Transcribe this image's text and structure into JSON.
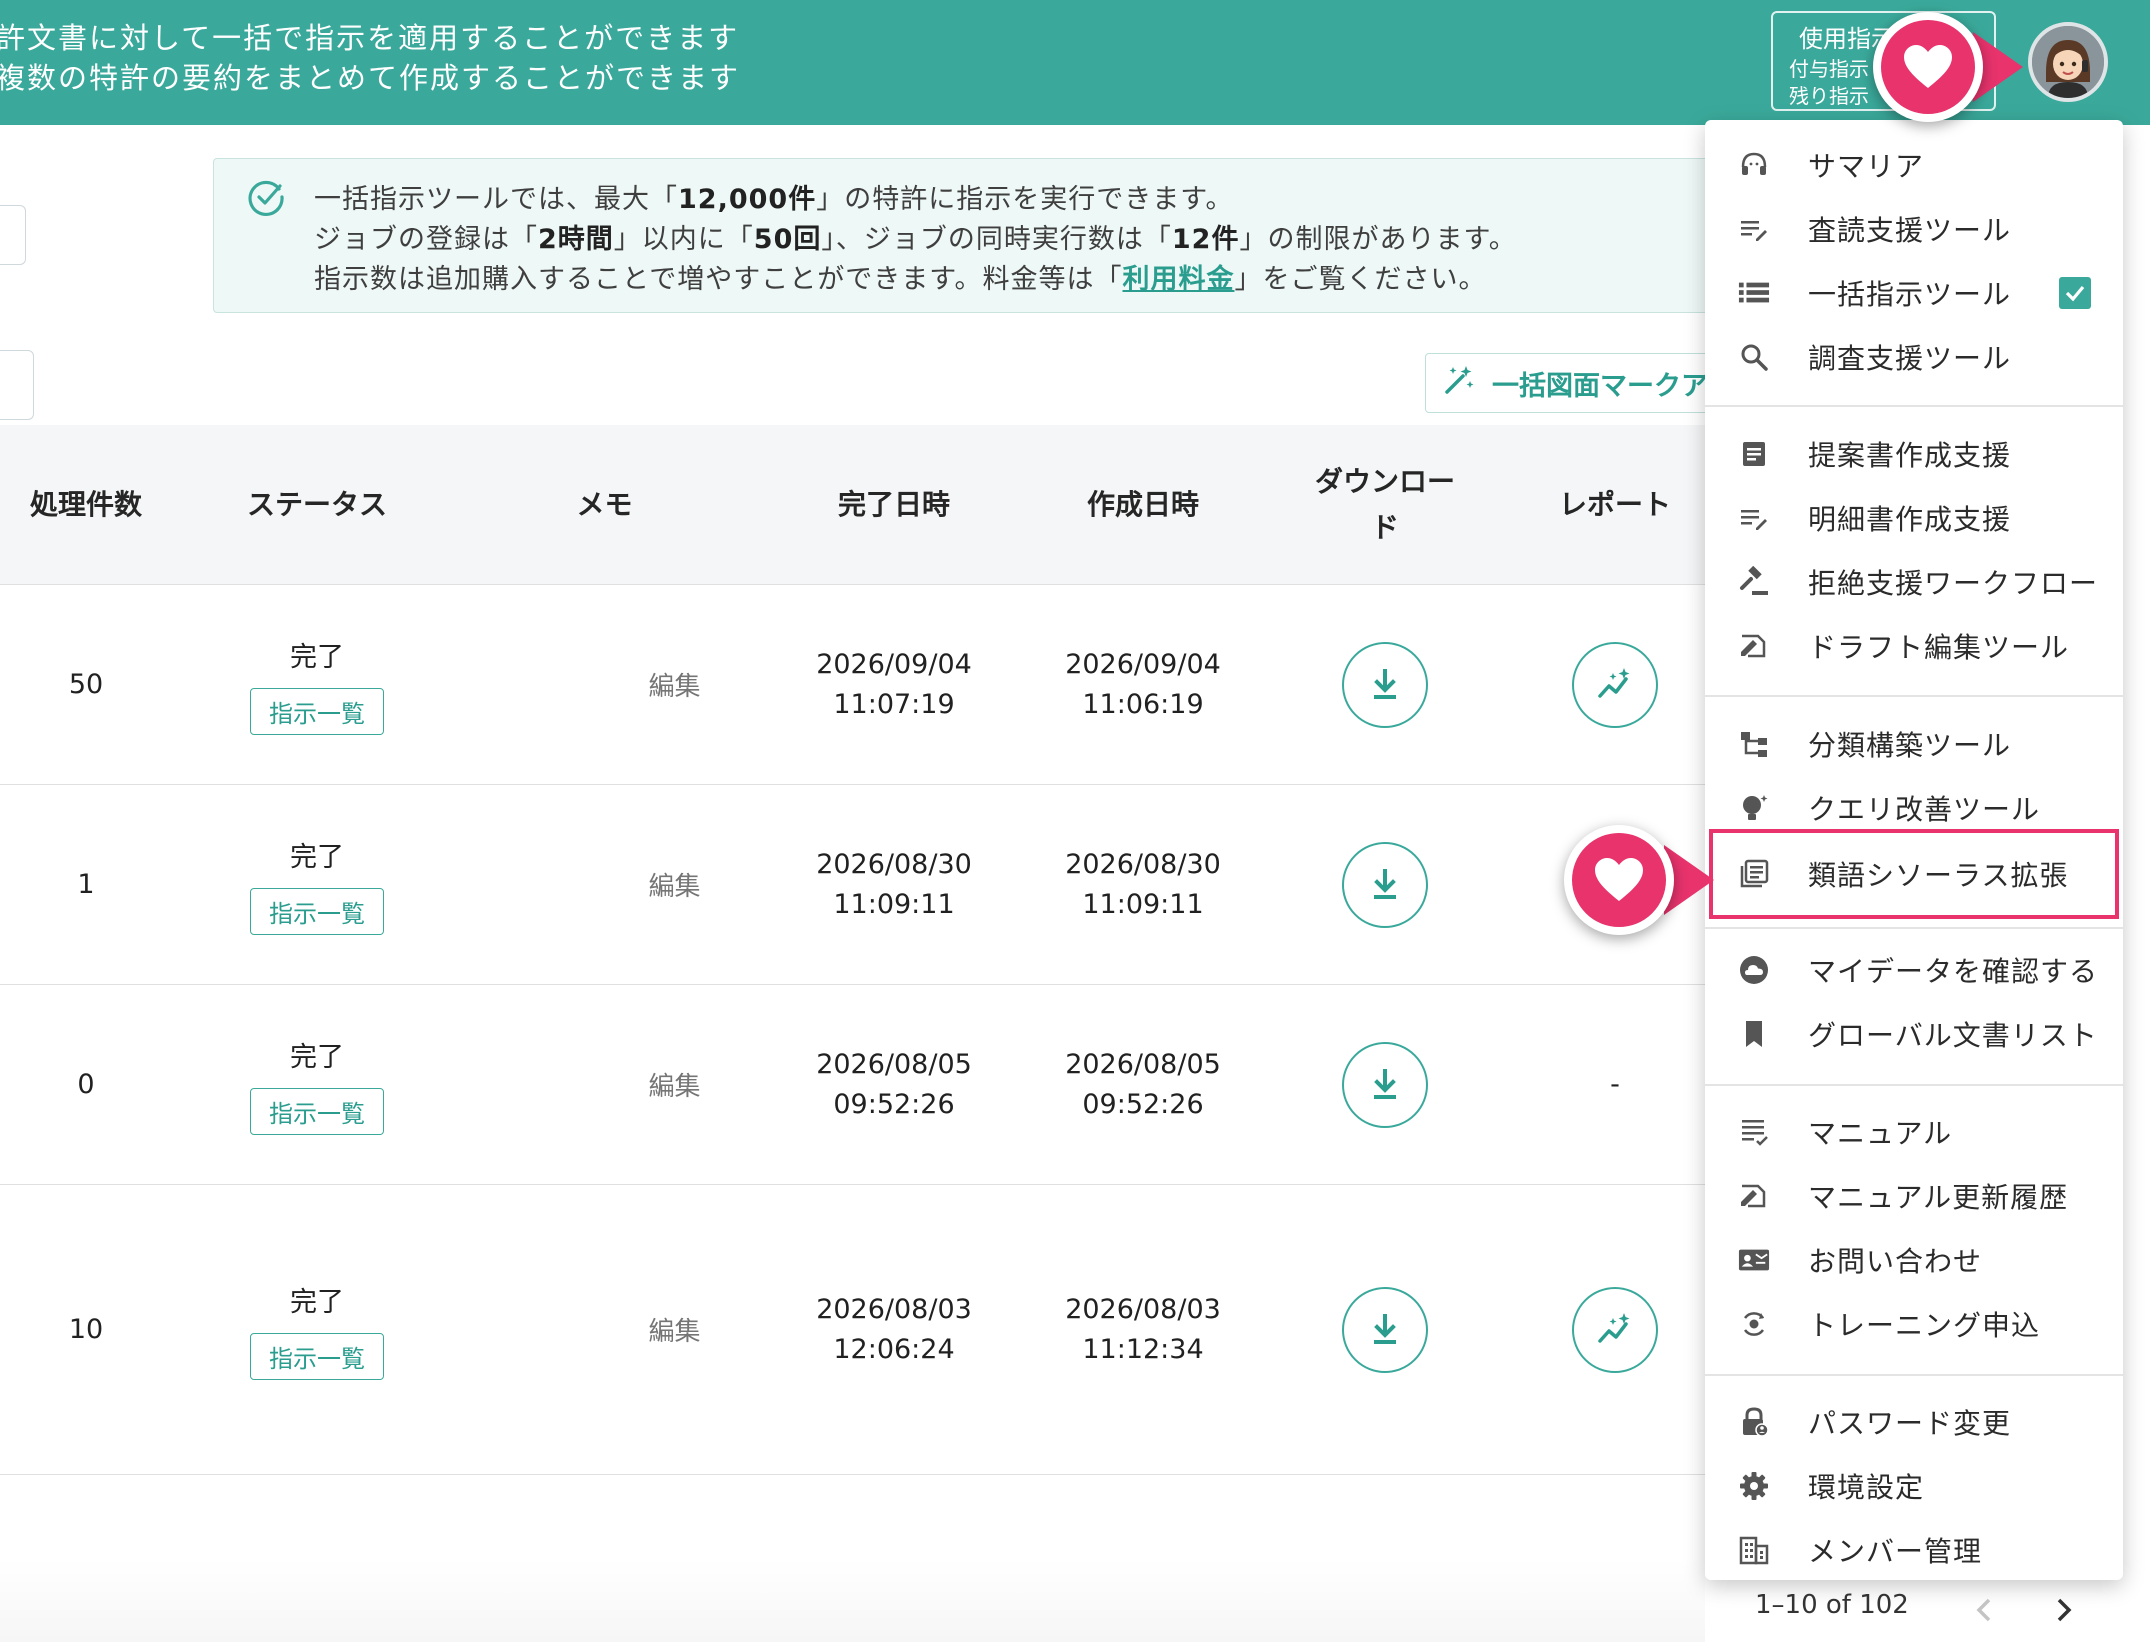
{
  "header": {
    "line1": "許文書に対して一括で指示を適用することができます",
    "line2": "複数の特許の要約をまとめて作成することができます",
    "usage": {
      "title": "使用指示",
      "granted": "付与指示",
      "remaining": "残り指示"
    }
  },
  "info": {
    "l1_pre": "一括指示ツールでは、最大「",
    "l1_bold": "12,000件",
    "l1_post": "」の特許に指示を実行できます。",
    "l2_pre": "ジョブの登録は「",
    "l2_b1": "2時間",
    "l2_mid1": "」以内に「",
    "l2_b2": "50回",
    "l2_mid2": "」、ジョブの同時実行数は「",
    "l2_b3": "12件",
    "l2_post": "」の制限があります。",
    "l3_pre": "指示数は追加購入することで増やすことができます。料金等は「",
    "l3_link": "利用料金",
    "l3_post": "」をご覧ください。"
  },
  "toolbar": {
    "bulk_figure_label": "一括図面マークア"
  },
  "table": {
    "headers": {
      "count": "処理件数",
      "status": "ステータス",
      "memo": "メモ",
      "completed": "完了日時",
      "created": "作成日時",
      "download_1": "ダウンロー",
      "download_2": "ド",
      "report": "レポート"
    },
    "rows": [
      {
        "count": "50",
        "status": "完了",
        "list_label": "指示一覧",
        "memo": "編集",
        "completed_date": "2026/09/04",
        "completed_time": "11:07:19",
        "created_date": "2026/09/04",
        "created_time": "11:06:19",
        "report": "icon"
      },
      {
        "count": "1",
        "status": "完了",
        "list_label": "指示一覧",
        "memo": "編集",
        "completed_date": "2026/08/30",
        "completed_time": "11:09:11",
        "created_date": "2026/08/30",
        "created_time": "11:09:11",
        "report": "marker"
      },
      {
        "count": "0",
        "status": "完了",
        "list_label": "指示一覧",
        "memo": "編集",
        "completed_date": "2026/08/05",
        "completed_time": "09:52:26",
        "created_date": "2026/08/05",
        "created_time": "09:52:26",
        "report": "-"
      },
      {
        "count": "10",
        "status": "完了",
        "list_label": "指示一覧",
        "memo": "編集",
        "completed_date": "2026/08/03",
        "completed_time": "12:06:24",
        "created_date": "2026/08/03",
        "created_time": "11:12:34",
        "report": "icon"
      }
    ]
  },
  "menu": {
    "items": [
      {
        "label": "サマリア",
        "icon": "headset-icon"
      },
      {
        "label": "査読支援ツール",
        "icon": "list-edit-icon"
      },
      {
        "label": "一括指示ツール",
        "icon": "list-icon",
        "checked": true
      },
      {
        "label": "調査支援ツール",
        "icon": "search-icon"
      },
      {
        "label": "提案書作成支援",
        "icon": "document-icon"
      },
      {
        "label": "明細書作成支援",
        "icon": "list-edit-icon"
      },
      {
        "label": "拒絶支援ワークフロー",
        "icon": "gavel-icon"
      },
      {
        "label": "ドラフト編集ツール",
        "icon": "draft-icon"
      },
      {
        "label": "分類構築ツール",
        "icon": "tree-icon"
      },
      {
        "label": "クエリ改善ツール",
        "icon": "lightbulb-icon"
      },
      {
        "label": "類語シソーラス拡張",
        "icon": "library-icon",
        "highlighted": true
      },
      {
        "label": "マイデータを確認する",
        "icon": "cloud-icon"
      },
      {
        "label": "グローバル文書リスト",
        "icon": "bookmark-icon"
      },
      {
        "label": "マニュアル",
        "icon": "manual-icon"
      },
      {
        "label": "マニュアル更新履歴",
        "icon": "draft-icon"
      },
      {
        "label": "お問い合わせ",
        "icon": "contact-icon"
      },
      {
        "label": "トレーニング申込",
        "icon": "training-icon"
      },
      {
        "label": "パスワード変更",
        "icon": "lock-icon"
      },
      {
        "label": "環境設定",
        "icon": "gear-icon"
      },
      {
        "label": "メンバー管理",
        "icon": "building-icon"
      }
    ]
  },
  "pagination": {
    "range": "1–10 of 102"
  },
  "colors": {
    "primary": "#3aa99b",
    "accent": "#2a9d8f",
    "marker": "#e8336d"
  }
}
